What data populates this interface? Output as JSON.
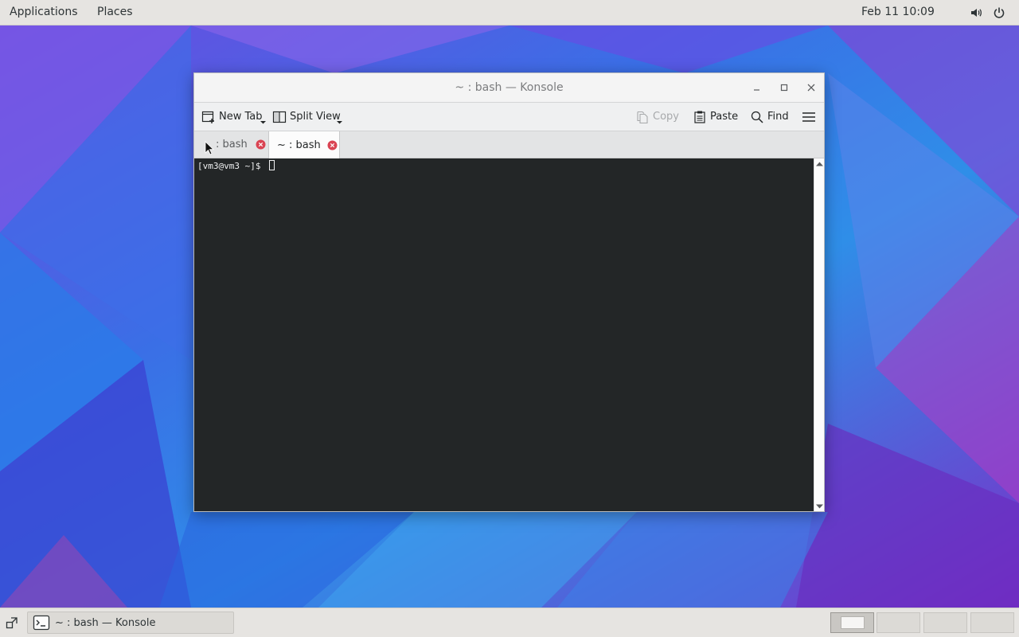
{
  "top_panel": {
    "applications": "Applications",
    "places": "Places",
    "clock": "Feb 11  10:09",
    "tray": [
      "volume-icon",
      "power-icon"
    ]
  },
  "window": {
    "title": "~ : bash — Konsole",
    "toolbar": {
      "new_tab": "New Tab",
      "split_view": "Split View",
      "copy": "Copy",
      "paste": "Paste",
      "find": "Find"
    },
    "tabs": [
      {
        "label": ": bash",
        "active": false
      },
      {
        "label": "~ : bash",
        "active": true
      }
    ],
    "terminal": {
      "prompt": "[vm3@vm3 ~]$ "
    }
  },
  "taskbar": {
    "task_label": "~ : bash — Konsole",
    "workspaces": 4,
    "active_workspace": 1
  },
  "colors": {
    "terminal_bg": "#232627",
    "panel_bg": "#e6e4e1",
    "close_tab": "#da4453"
  }
}
